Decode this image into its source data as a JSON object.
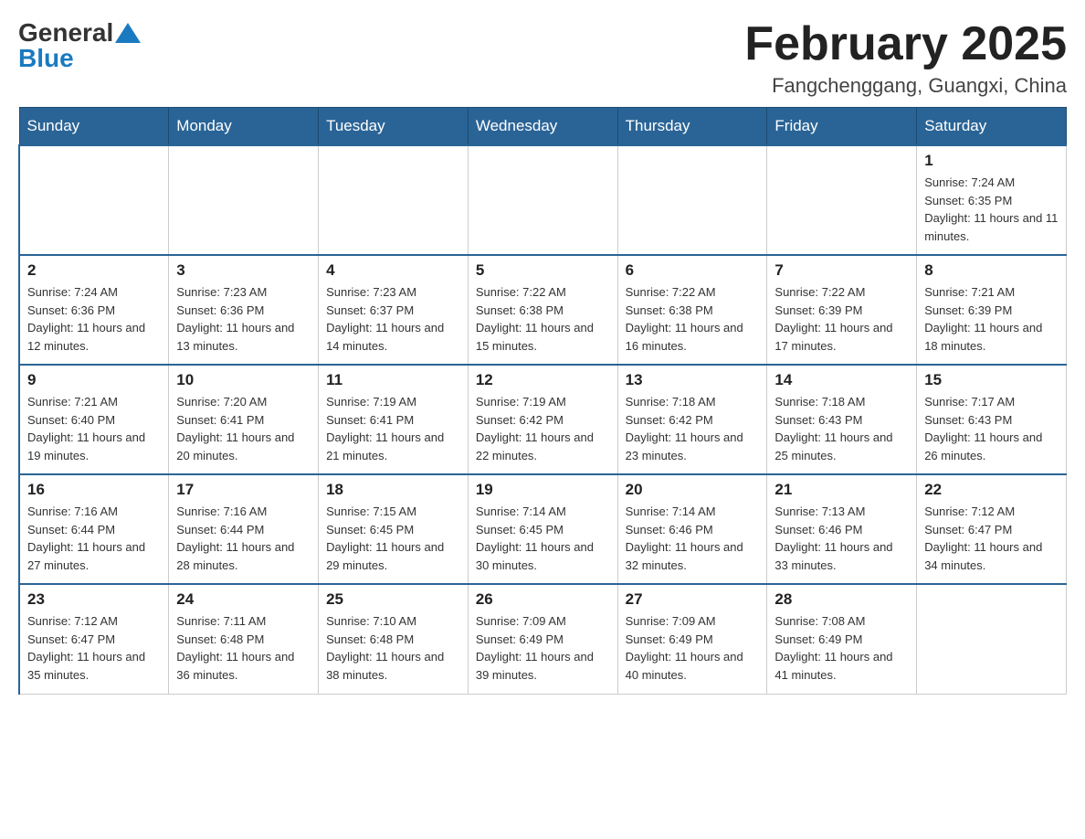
{
  "header": {
    "logo_general": "General",
    "logo_blue": "Blue",
    "title": "February 2025",
    "location": "Fangchenggang, Guangxi, China"
  },
  "days_of_week": [
    "Sunday",
    "Monday",
    "Tuesday",
    "Wednesday",
    "Thursday",
    "Friday",
    "Saturday"
  ],
  "weeks": [
    [
      {
        "day": "",
        "info": ""
      },
      {
        "day": "",
        "info": ""
      },
      {
        "day": "",
        "info": ""
      },
      {
        "day": "",
        "info": ""
      },
      {
        "day": "",
        "info": ""
      },
      {
        "day": "",
        "info": ""
      },
      {
        "day": "1",
        "info": "Sunrise: 7:24 AM\nSunset: 6:35 PM\nDaylight: 11 hours and 11 minutes."
      }
    ],
    [
      {
        "day": "2",
        "info": "Sunrise: 7:24 AM\nSunset: 6:36 PM\nDaylight: 11 hours and 12 minutes."
      },
      {
        "day": "3",
        "info": "Sunrise: 7:23 AM\nSunset: 6:36 PM\nDaylight: 11 hours and 13 minutes."
      },
      {
        "day": "4",
        "info": "Sunrise: 7:23 AM\nSunset: 6:37 PM\nDaylight: 11 hours and 14 minutes."
      },
      {
        "day": "5",
        "info": "Sunrise: 7:22 AM\nSunset: 6:38 PM\nDaylight: 11 hours and 15 minutes."
      },
      {
        "day": "6",
        "info": "Sunrise: 7:22 AM\nSunset: 6:38 PM\nDaylight: 11 hours and 16 minutes."
      },
      {
        "day": "7",
        "info": "Sunrise: 7:22 AM\nSunset: 6:39 PM\nDaylight: 11 hours and 17 minutes."
      },
      {
        "day": "8",
        "info": "Sunrise: 7:21 AM\nSunset: 6:39 PM\nDaylight: 11 hours and 18 minutes."
      }
    ],
    [
      {
        "day": "9",
        "info": "Sunrise: 7:21 AM\nSunset: 6:40 PM\nDaylight: 11 hours and 19 minutes."
      },
      {
        "day": "10",
        "info": "Sunrise: 7:20 AM\nSunset: 6:41 PM\nDaylight: 11 hours and 20 minutes."
      },
      {
        "day": "11",
        "info": "Sunrise: 7:19 AM\nSunset: 6:41 PM\nDaylight: 11 hours and 21 minutes."
      },
      {
        "day": "12",
        "info": "Sunrise: 7:19 AM\nSunset: 6:42 PM\nDaylight: 11 hours and 22 minutes."
      },
      {
        "day": "13",
        "info": "Sunrise: 7:18 AM\nSunset: 6:42 PM\nDaylight: 11 hours and 23 minutes."
      },
      {
        "day": "14",
        "info": "Sunrise: 7:18 AM\nSunset: 6:43 PM\nDaylight: 11 hours and 25 minutes."
      },
      {
        "day": "15",
        "info": "Sunrise: 7:17 AM\nSunset: 6:43 PM\nDaylight: 11 hours and 26 minutes."
      }
    ],
    [
      {
        "day": "16",
        "info": "Sunrise: 7:16 AM\nSunset: 6:44 PM\nDaylight: 11 hours and 27 minutes."
      },
      {
        "day": "17",
        "info": "Sunrise: 7:16 AM\nSunset: 6:44 PM\nDaylight: 11 hours and 28 minutes."
      },
      {
        "day": "18",
        "info": "Sunrise: 7:15 AM\nSunset: 6:45 PM\nDaylight: 11 hours and 29 minutes."
      },
      {
        "day": "19",
        "info": "Sunrise: 7:14 AM\nSunset: 6:45 PM\nDaylight: 11 hours and 30 minutes."
      },
      {
        "day": "20",
        "info": "Sunrise: 7:14 AM\nSunset: 6:46 PM\nDaylight: 11 hours and 32 minutes."
      },
      {
        "day": "21",
        "info": "Sunrise: 7:13 AM\nSunset: 6:46 PM\nDaylight: 11 hours and 33 minutes."
      },
      {
        "day": "22",
        "info": "Sunrise: 7:12 AM\nSunset: 6:47 PM\nDaylight: 11 hours and 34 minutes."
      }
    ],
    [
      {
        "day": "23",
        "info": "Sunrise: 7:12 AM\nSunset: 6:47 PM\nDaylight: 11 hours and 35 minutes."
      },
      {
        "day": "24",
        "info": "Sunrise: 7:11 AM\nSunset: 6:48 PM\nDaylight: 11 hours and 36 minutes."
      },
      {
        "day": "25",
        "info": "Sunrise: 7:10 AM\nSunset: 6:48 PM\nDaylight: 11 hours and 38 minutes."
      },
      {
        "day": "26",
        "info": "Sunrise: 7:09 AM\nSunset: 6:49 PM\nDaylight: 11 hours and 39 minutes."
      },
      {
        "day": "27",
        "info": "Sunrise: 7:09 AM\nSunset: 6:49 PM\nDaylight: 11 hours and 40 minutes."
      },
      {
        "day": "28",
        "info": "Sunrise: 7:08 AM\nSunset: 6:49 PM\nDaylight: 11 hours and 41 minutes."
      },
      {
        "day": "",
        "info": ""
      }
    ]
  ]
}
